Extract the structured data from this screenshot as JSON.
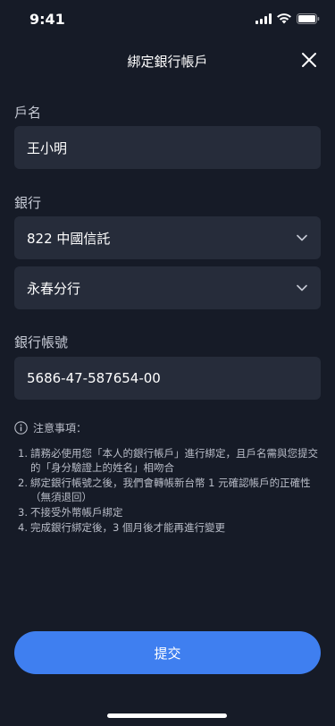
{
  "status_bar": {
    "time": "9:41"
  },
  "header": {
    "title": "綁定銀行帳戶"
  },
  "form": {
    "account_name_label": "戶名",
    "account_name_value": "王小明",
    "bank_label": "銀行",
    "bank_value": "822 中國信託",
    "branch_value": "永春分行",
    "account_number_label": "銀行帳號",
    "account_number_value": "5686-47-587654-00"
  },
  "notice": {
    "title": "注意事項：",
    "items": [
      {
        "num": "1.",
        "text": "請務必使用您「本人的銀行帳戶」進行綁定，且戶名需與您提交的「身分驗證上的姓名」相吻合"
      },
      {
        "num": "2.",
        "text": "綁定銀行帳號之後，我們會轉帳新台幣 1 元確認帳戶的正確性（無須退回）"
      },
      {
        "num": "3.",
        "text": "不接受外幣帳戶綁定"
      },
      {
        "num": "4.",
        "text": "完成銀行綁定後，3 個月後才能再進行變更"
      }
    ]
  },
  "submit_label": "提交"
}
